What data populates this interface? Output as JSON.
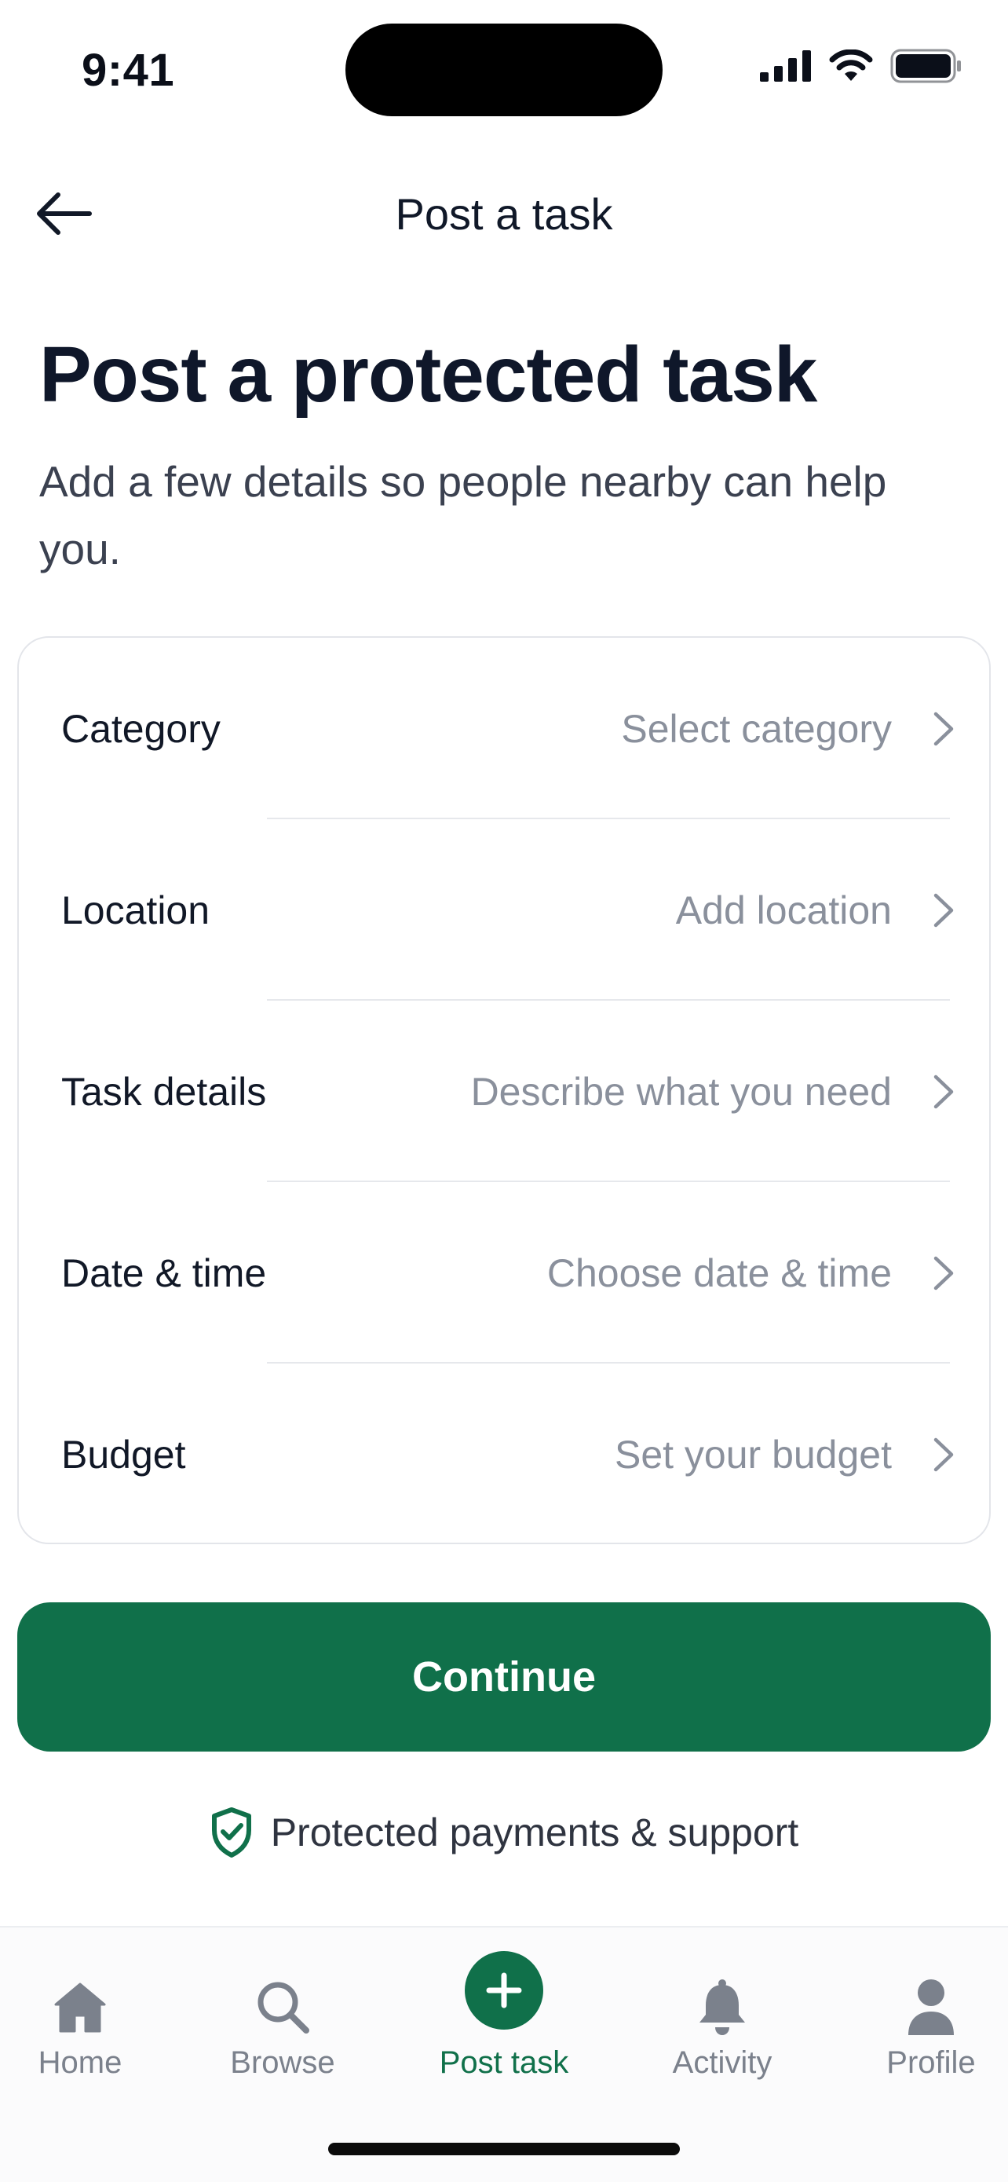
{
  "status_bar": {
    "time": "9:41"
  },
  "nav": {
    "title": "Post a task",
    "back_icon": "arrow-left-icon"
  },
  "hero": {
    "title": "Post a protected task",
    "subtitle": "Add a few details so people nearby can help you."
  },
  "form": {
    "rows": [
      {
        "label": "Category",
        "placeholder": "Select category"
      },
      {
        "label": "Location",
        "placeholder": "Add location"
      },
      {
        "label": "Task details",
        "placeholder": "Describe what you need"
      },
      {
        "label": "Date & time",
        "placeholder": "Choose date & time"
      },
      {
        "label": "Budget",
        "placeholder": "Set your budget"
      }
    ]
  },
  "continue_button": {
    "label": "Continue"
  },
  "protection": {
    "text": "Protected payments & support",
    "icon": "shield-check-icon"
  },
  "tab_bar": {
    "active": "Post task",
    "items": [
      {
        "label": "Home",
        "icon": "home-icon"
      },
      {
        "label": "Browse",
        "icon": "search-icon"
      },
      {
        "label": "Post task",
        "icon": "plus-icon"
      },
      {
        "label": "Activity",
        "icon": "bell-icon"
      },
      {
        "label": "Profile",
        "icon": "person-icon"
      }
    ]
  },
  "colors": {
    "brand_green": "#10704a",
    "text_primary": "#101828",
    "text_placeholder": "#8a909c",
    "tab_inactive": "#7b818c"
  }
}
